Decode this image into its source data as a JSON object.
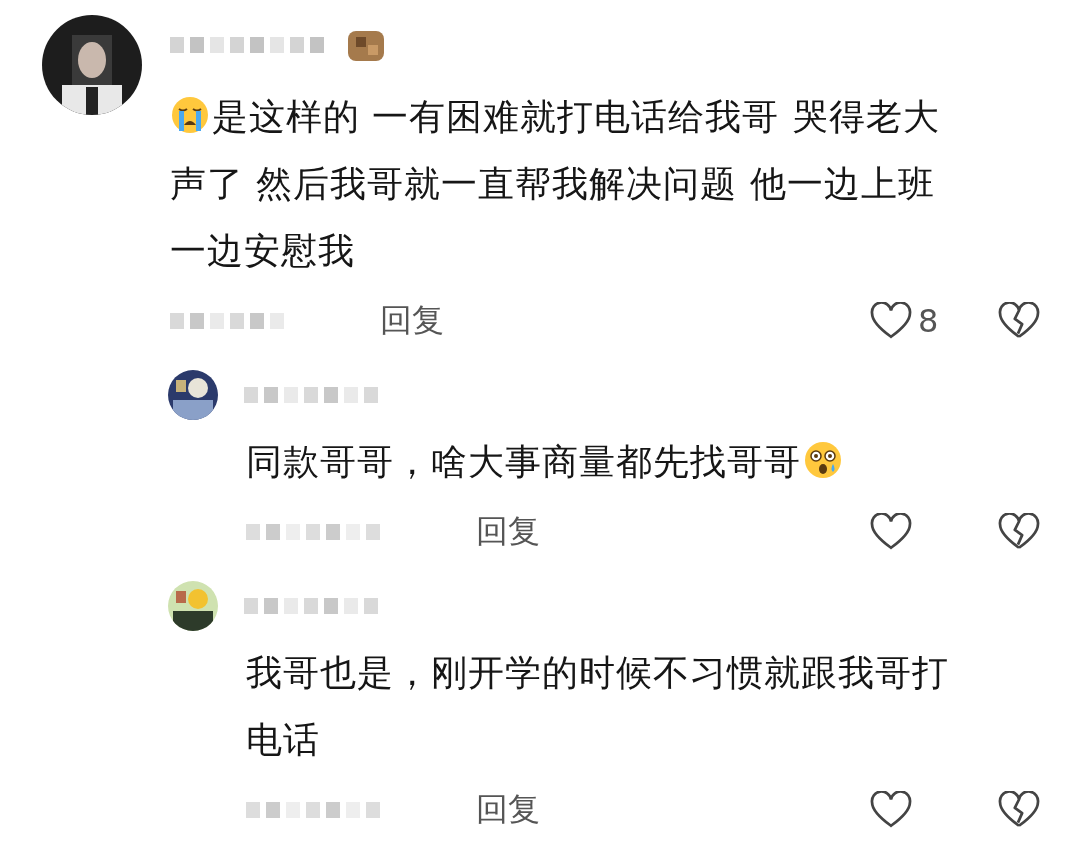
{
  "comments": [
    {
      "segments": [
        {
          "kind": "crying-emoji"
        },
        {
          "kind": "text",
          "text": "是这样的 一有困难就打电话给我哥 哭得老大声了 然后我哥就一直帮我解决问题 他一边上班一边安慰我"
        }
      ],
      "reply_label": "回复",
      "likes": "8",
      "replies": [
        {
          "segments": [
            {
              "kind": "text",
              "text": "同款哥哥，啥大事商量都先找哥哥"
            },
            {
              "kind": "surprised-emoji"
            }
          ],
          "reply_label": "回复"
        },
        {
          "segments": [
            {
              "kind": "text",
              "text": "我哥也是，刚开学的时候不习惯就跟我哥打电话"
            }
          ],
          "reply_label": "回复"
        }
      ]
    }
  ]
}
